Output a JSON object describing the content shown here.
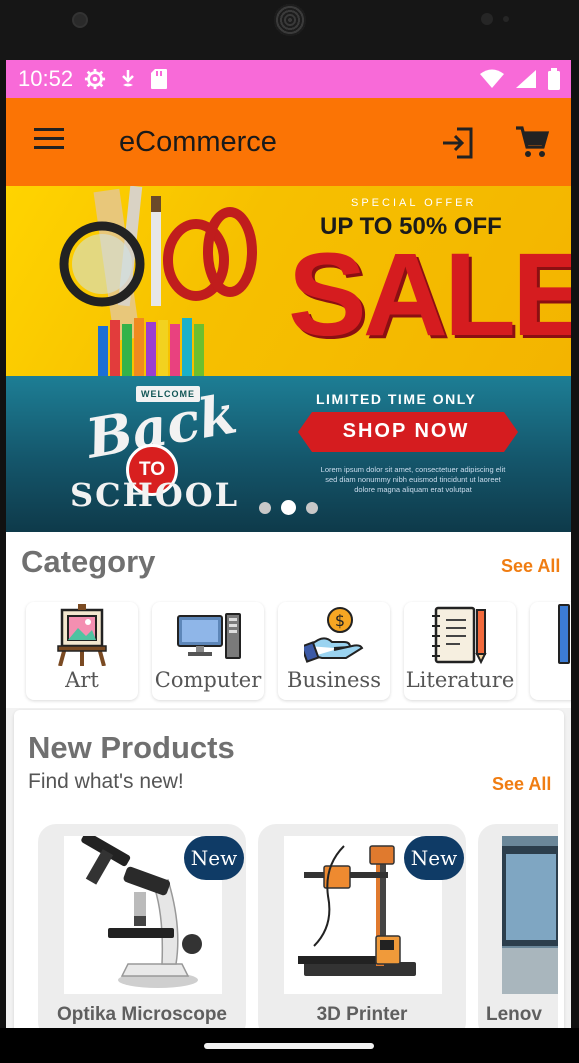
{
  "status_bar": {
    "time": "10:52",
    "icons_left": [
      "gear-icon",
      "download-icon",
      "sd-card-icon"
    ],
    "icons_right": [
      "wifi-icon",
      "signal-icon",
      "battery-icon"
    ],
    "background": "#f86ad8"
  },
  "app_bar": {
    "title": "eCommerce",
    "background": "#fb7405",
    "icons": [
      "menu-icon",
      "login-icon",
      "cart-icon"
    ]
  },
  "banner": {
    "special_offer": "SPECIAL OFFER",
    "headline": "UP TO 50% OFF",
    "sale": "SALE",
    "welcome": "WELCOME",
    "back": "Back",
    "to": "TO",
    "school": "SCHOOL",
    "limited": "LIMITED TIME ONLY",
    "cta": "SHOP NOW",
    "body_text": "Lorem ipsum dolor sit amet, consectetuer adipiscing elit sed diam nonummy nibh euismod tincidunt ut laoreet dolore magna aliquam erat volutpat",
    "slides": 3,
    "active_slide": 2
  },
  "category": {
    "title": "Category",
    "see_all": "See All",
    "items": [
      {
        "label": "Art",
        "icon": "easel-icon"
      },
      {
        "label": "Computer",
        "icon": "computer-icon"
      },
      {
        "label": "Business",
        "icon": "money-hand-icon"
      },
      {
        "label": "Literature",
        "icon": "notebook-icon"
      }
    ]
  },
  "new_products": {
    "title": "New Products",
    "subtitle": "Find what's new!",
    "see_all": "See All",
    "items": [
      {
        "name": "Optika Microscope",
        "badge": "New"
      },
      {
        "name": "3D Printer",
        "badge": "New"
      },
      {
        "name": "Lenov",
        "badge": ""
      }
    ]
  },
  "colors": {
    "accent": "#f07d12",
    "badge": "#0f3b66",
    "sale_red": "#d51c1f"
  }
}
